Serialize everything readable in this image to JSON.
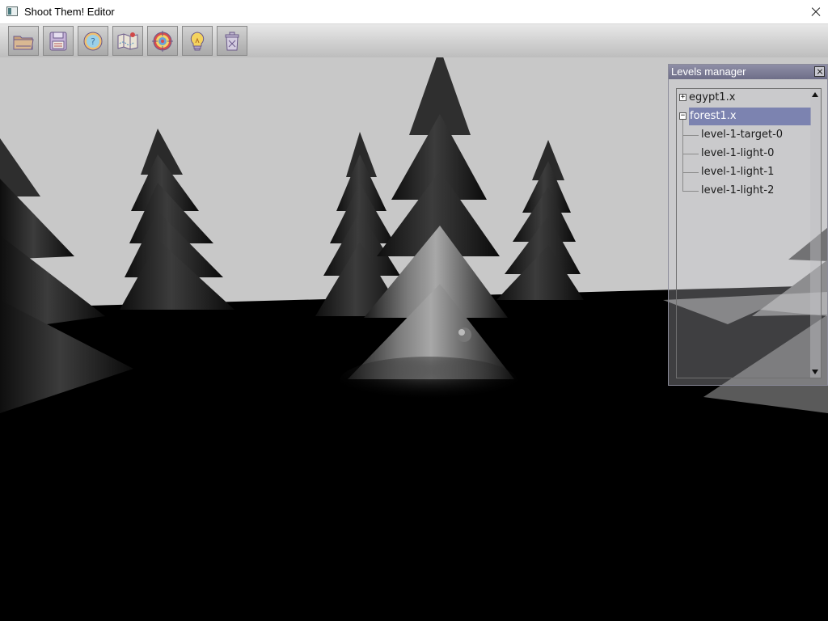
{
  "window": {
    "title": "Shoot Them! Editor"
  },
  "toolbar": {
    "buttons": [
      {
        "icon": "open-folder-icon"
      },
      {
        "icon": "save-floppy-icon"
      },
      {
        "icon": "help-icon"
      },
      {
        "icon": "map-icon"
      },
      {
        "icon": "target-icon"
      },
      {
        "icon": "lightbulb-icon"
      },
      {
        "icon": "trash-can-icon"
      }
    ]
  },
  "levels_manager": {
    "title": "Levels manager",
    "tree": [
      {
        "label": "egypt1.x",
        "expanded": false
      },
      {
        "label": "forest1.x",
        "expanded": true,
        "selected": true,
        "children": [
          "level-1-target-0",
          "level-1-light-0",
          "level-1-light-1",
          "level-1-light-2"
        ]
      }
    ],
    "expand_symbol": "+",
    "collapse_symbol": "−"
  },
  "colors": {
    "sky": "#c8c8c8",
    "ground": "#000000",
    "selection": "#7c83b0",
    "panel_header": "#7a7a92"
  }
}
